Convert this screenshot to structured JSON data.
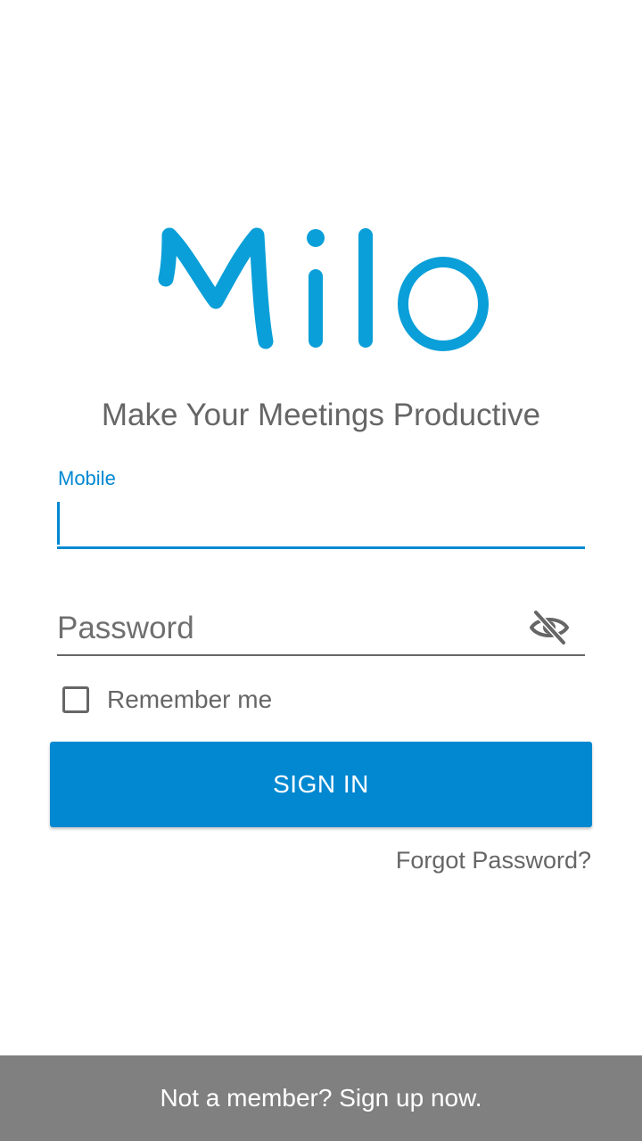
{
  "brand": {
    "logo_text": "Milo",
    "tagline": "Make Your Meetings Productive"
  },
  "form": {
    "mobile": {
      "label": "Mobile",
      "value": ""
    },
    "password": {
      "placeholder": "Password",
      "value": "",
      "toggle_icon": "eye-off-icon"
    },
    "remember": {
      "label": "Remember me",
      "checked": false
    },
    "signin_label": "SIGN IN",
    "forgot_label": "Forgot Password?"
  },
  "footer": {
    "signup_text": "Not a member? Sign up now."
  },
  "colors": {
    "accent": "#0288d1",
    "logo": "#0a9fd8",
    "text": "#666666",
    "footer_bg": "#808080"
  }
}
